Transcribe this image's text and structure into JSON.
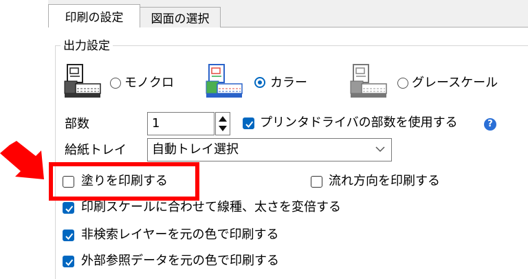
{
  "tabs": [
    {
      "label": "印刷の設定"
    },
    {
      "label": "図面の選択"
    }
  ],
  "output_group": {
    "title": "出力設定",
    "color_modes": [
      {
        "label": "モノクロ",
        "selected": false,
        "icon": "printer-mono-icon"
      },
      {
        "label": "カラー",
        "selected": true,
        "icon": "printer-color-icon"
      },
      {
        "label": "グレースケール",
        "selected": false,
        "icon": "printer-gray-icon"
      }
    ],
    "copies_label": "部数",
    "copies_value": "1",
    "use_driver_copies_label": "プリンタドライバの部数を使用する",
    "tray_label": "給紙トレイ",
    "tray_value": "自動トレイ選択",
    "options": [
      {
        "label": "塗りを印刷する",
        "checked": false
      },
      {
        "label": "流れ方向を印刷する",
        "checked": false
      },
      {
        "label": "印刷スケールに合わせて線種、太さを変倍する",
        "checked": true
      },
      {
        "label": "非検索レイヤーを元の色で印刷する",
        "checked": true
      },
      {
        "label": "外部参照データを元の色で印刷する",
        "checked": true
      }
    ]
  },
  "annotation": {
    "arrow_color": "#ff0000",
    "box_color": "#ff0000"
  },
  "colors": {
    "accent": "#0067c0",
    "help": "#2a6fd6"
  }
}
